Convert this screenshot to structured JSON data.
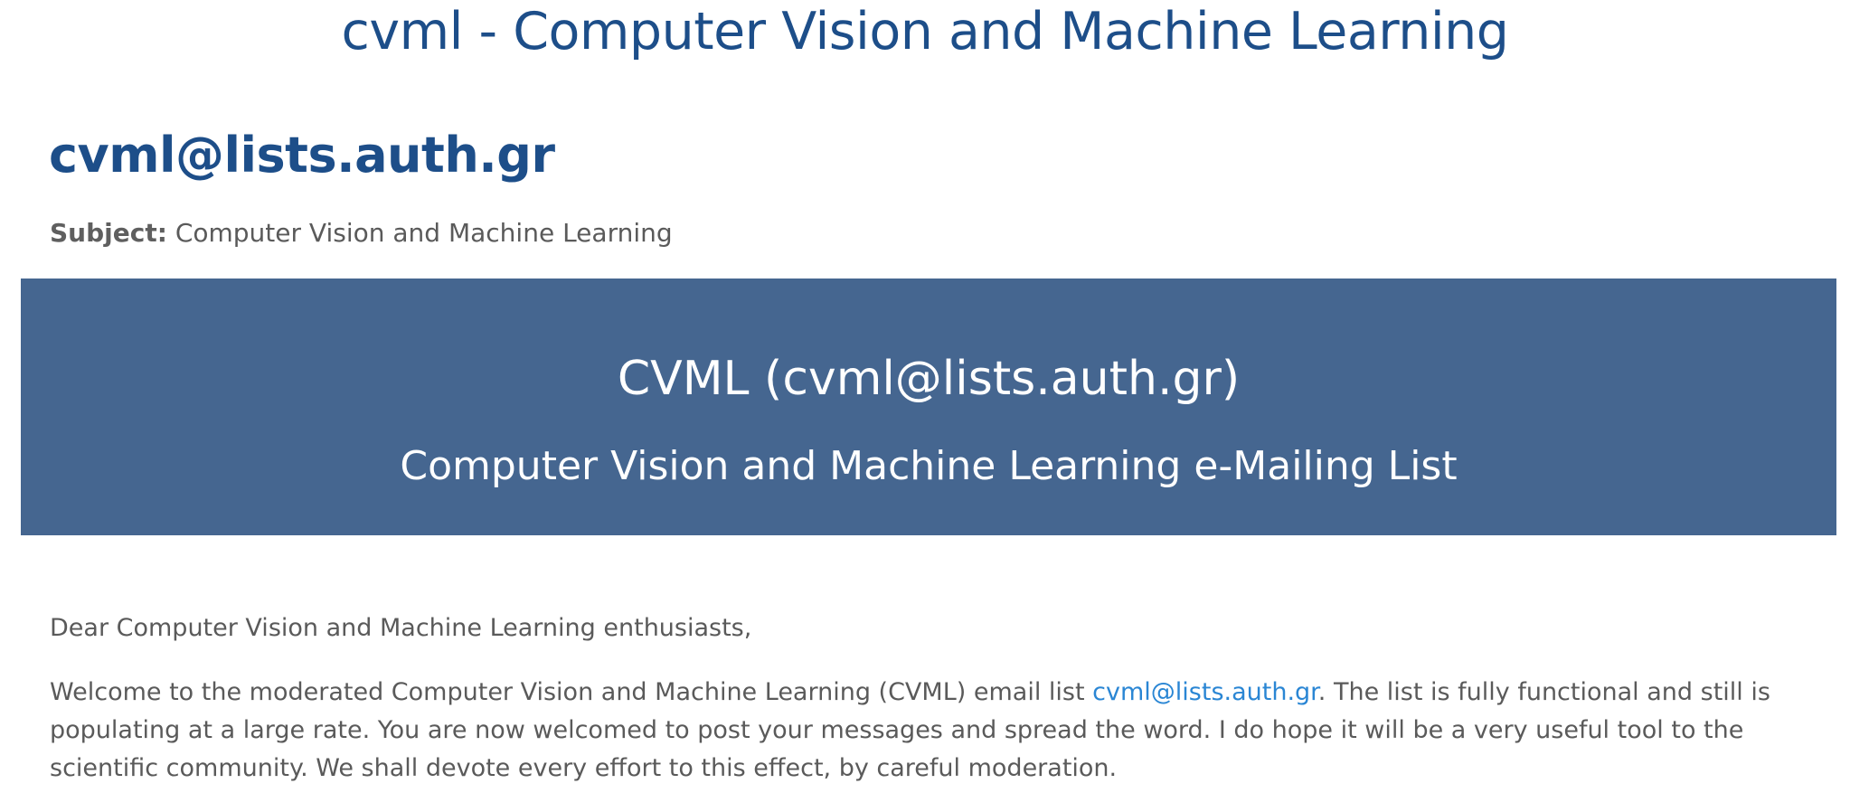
{
  "page": {
    "title": "cvml - Computer Vision and Machine Learning",
    "list_address": "cvml@lists.auth.gr",
    "subject_label": "Subject:",
    "subject_value": "Computer Vision and Machine Learning"
  },
  "banner": {
    "title": "CVML (cvml@lists.auth.gr)",
    "subtitle": "Computer Vision and Machine Learning e-Mailing List",
    "background_color": "#456690"
  },
  "content": {
    "greeting": "Dear Computer Vision and Machine Learning enthusiasts,",
    "welcome_before_link": "Welcome to the moderated Computer Vision and Machine Learning  (CVML) email list ",
    "welcome_link": "cvml@lists.auth.gr",
    "welcome_after_link": ". The list is fully functional and still is populating at a large rate. You are now welcomed to post your messages and spread the word. I do hope it will be a very useful tool to the scientific community. We shall devote every effort to this effect, by careful moderation."
  },
  "colors": {
    "heading": "#1d4e89",
    "text": "#5a5a5a",
    "link": "#2a86d4"
  }
}
